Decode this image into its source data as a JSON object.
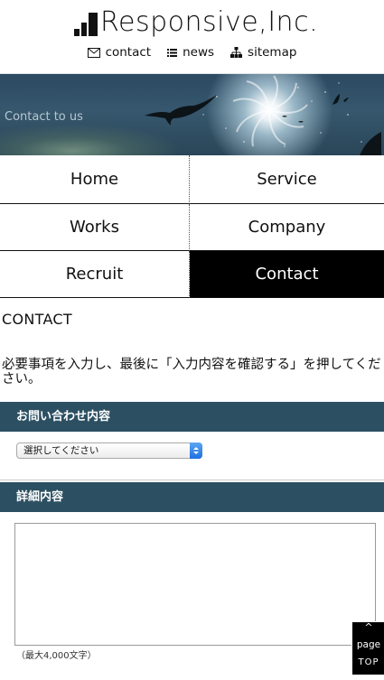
{
  "header": {
    "logo_text": "Responsive,Inc.",
    "links": {
      "contact": "contact",
      "news": "news",
      "sitemap": "sitemap"
    }
  },
  "banner": {
    "title": "Contact to us"
  },
  "nav": {
    "home": "Home",
    "service": "Service",
    "works": "Works",
    "company": "Company",
    "recruit": "Recruit",
    "contact": "Contact"
  },
  "main": {
    "page_title": "CONTACT",
    "intro": "必要事項を入力し、最後に「入力内容を確認する」を押してください。",
    "inquiry": {
      "heading": "お問い合わせ内容",
      "select_value": "選択してください"
    },
    "detail": {
      "heading": "詳細内容",
      "textarea_value": "",
      "note": "（最大4,000文字）"
    }
  },
  "pagetop": {
    "caret": "^",
    "line1": "page",
    "line2": "TOP"
  },
  "colors": {
    "section_heading_bg": "#2c4f62",
    "active_nav_bg": "#000000",
    "select_arrow": "#1f6fe0"
  }
}
